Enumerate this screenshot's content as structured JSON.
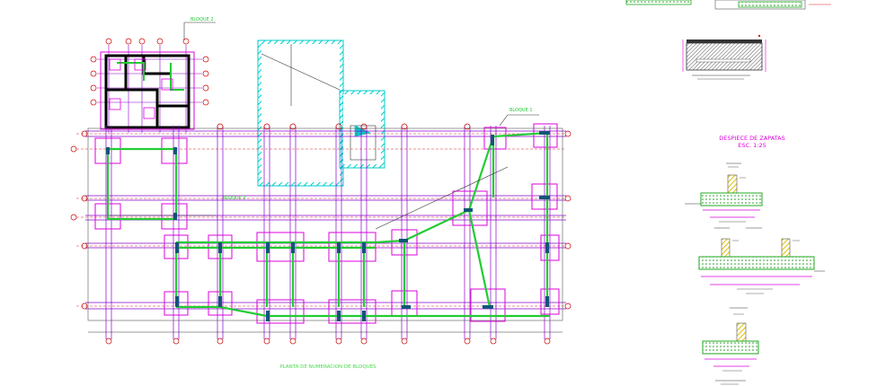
{
  "drawing": {
    "plan_title": "PLANTA DE NUMERACION DE BLOQUES",
    "block_labels": [
      "BLOQUE 2",
      "BLOQUE 1",
      "BLOQUE 3"
    ],
    "detail_title_line1": "DESPIECE DE ZAPATAS",
    "detail_title_line2": "ESC. 1:25"
  },
  "colors": {
    "grid_axis": "#8800cc",
    "dashed_red": "#dd2222",
    "beam_green": "#22cc33",
    "column_black": "#000000",
    "footing_magenta": "#dd00dd",
    "hatch_cyan": "#00cccc",
    "title_green": "#44dd44",
    "detail_title_magenta": "#dd00dd",
    "detail_yellow": "#ffdd00",
    "bubble_red": "#cc0000"
  },
  "legend": {
    "icons": [
      "grid-bubble-icon",
      "footing-icon",
      "column-icon",
      "hatch-icon"
    ]
  }
}
